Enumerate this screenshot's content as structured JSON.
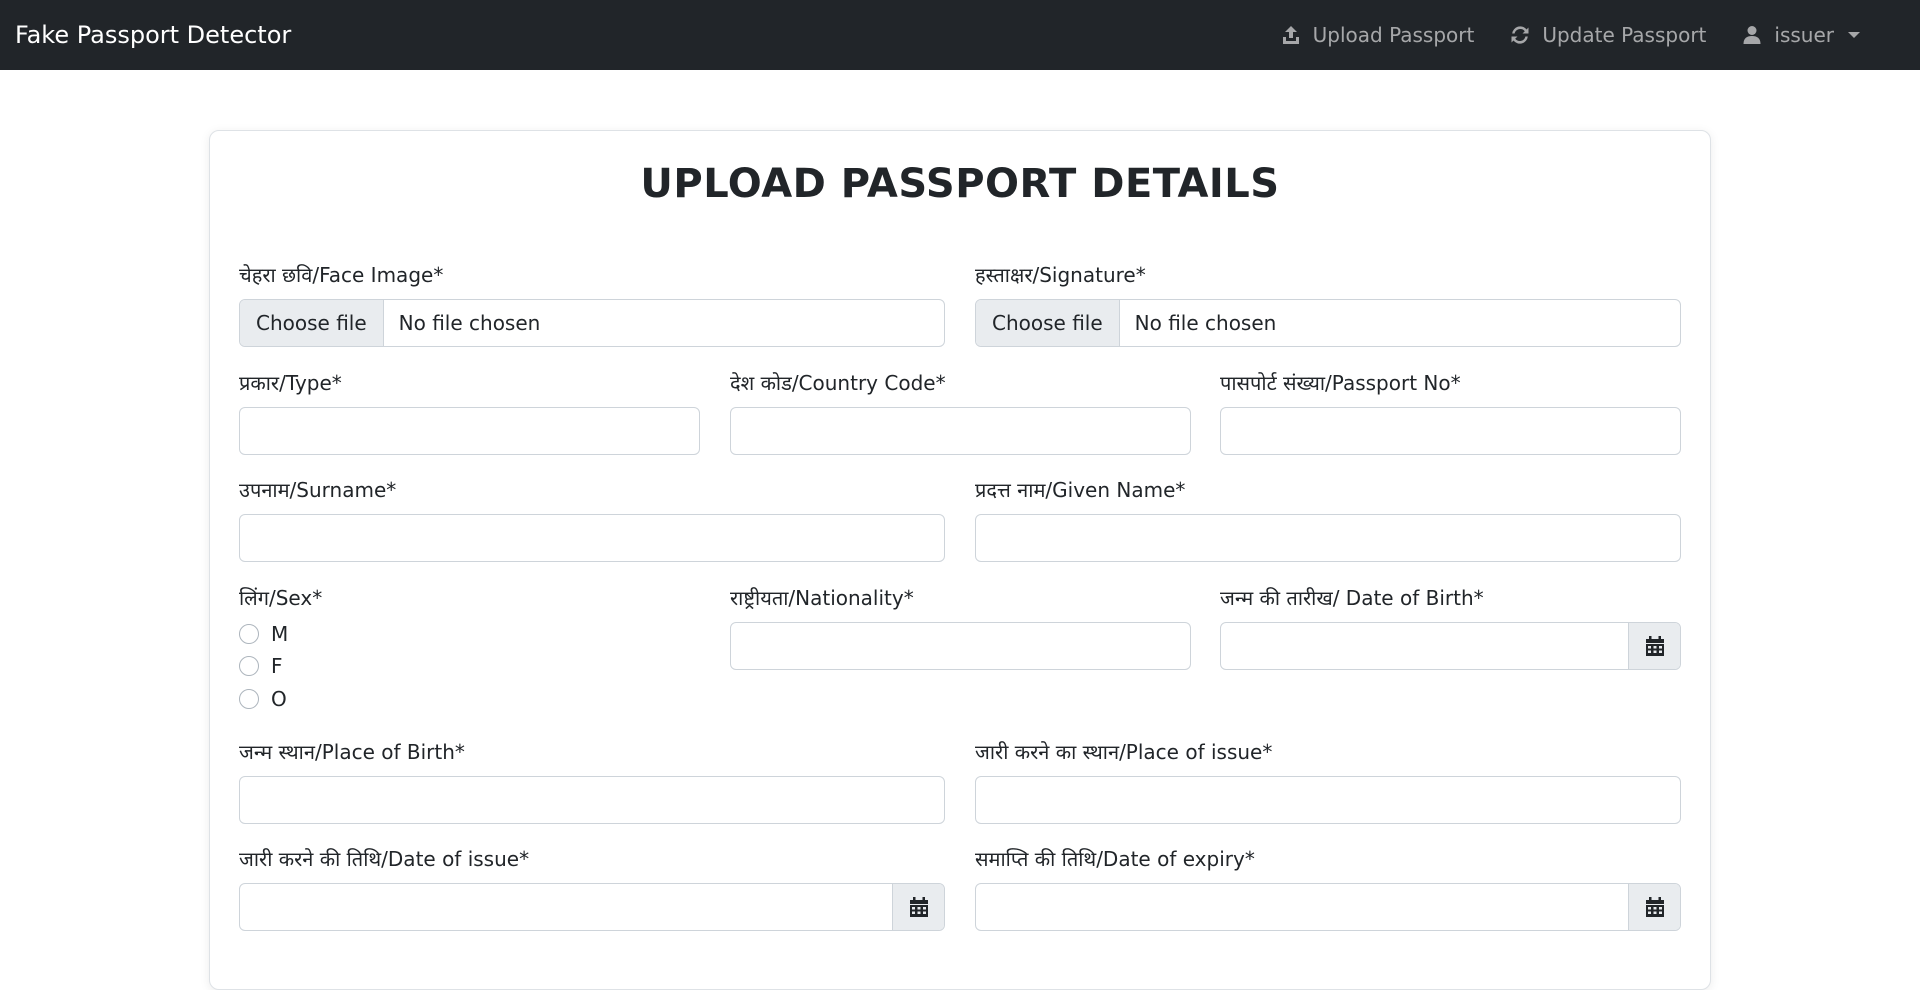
{
  "navbar": {
    "brand": "Fake Passport Detector",
    "links": [
      {
        "label": "Upload Passport",
        "icon": "upload-icon"
      },
      {
        "label": "Update Passport",
        "icon": "refresh-icon"
      }
    ],
    "user": {
      "label": "issuer",
      "icon": "user-icon"
    }
  },
  "form": {
    "title": "UPLOAD PASSPORT DETAILS",
    "face_image": {
      "label": "चेहरा छवि/Face Image*",
      "button": "Choose file",
      "status": "No file chosen"
    },
    "signature": {
      "label": "हस्ताक्षर/Signature*",
      "button": "Choose file",
      "status": "No file chosen"
    },
    "type": {
      "label": "प्रकार/Type*",
      "value": ""
    },
    "country_code": {
      "label": "देश कोड/Country Code*",
      "value": ""
    },
    "passport_no": {
      "label": "पासपोर्ट संख्या/Passport No*",
      "value": ""
    },
    "surname": {
      "label": "उपनाम/Surname*",
      "value": ""
    },
    "given_name": {
      "label": "प्रदत्त नाम/Given Name*",
      "value": ""
    },
    "sex": {
      "label": "लिंग/Sex*",
      "options": [
        "M",
        "F",
        "O"
      ]
    },
    "nationality": {
      "label": "राष्ट्रीयता/Nationality*",
      "value": ""
    },
    "dob": {
      "label": "जन्म की तारीख/ Date of Birth*",
      "value": ""
    },
    "place_of_birth": {
      "label": "जन्म स्थान/Place of Birth*",
      "value": ""
    },
    "place_of_issue": {
      "label": "जारी करने का स्थान/Place of issue*",
      "value": ""
    },
    "date_of_issue": {
      "label": "जारी करने की तिथि/Date of issue*",
      "value": ""
    },
    "date_of_expiry": {
      "label": "समाप्ति की तिथि/Date of expiry*",
      "value": ""
    }
  },
  "colors": {
    "navbar_bg": "#212529",
    "input_border": "#ced4da",
    "addon_bg": "#e9ecef"
  }
}
